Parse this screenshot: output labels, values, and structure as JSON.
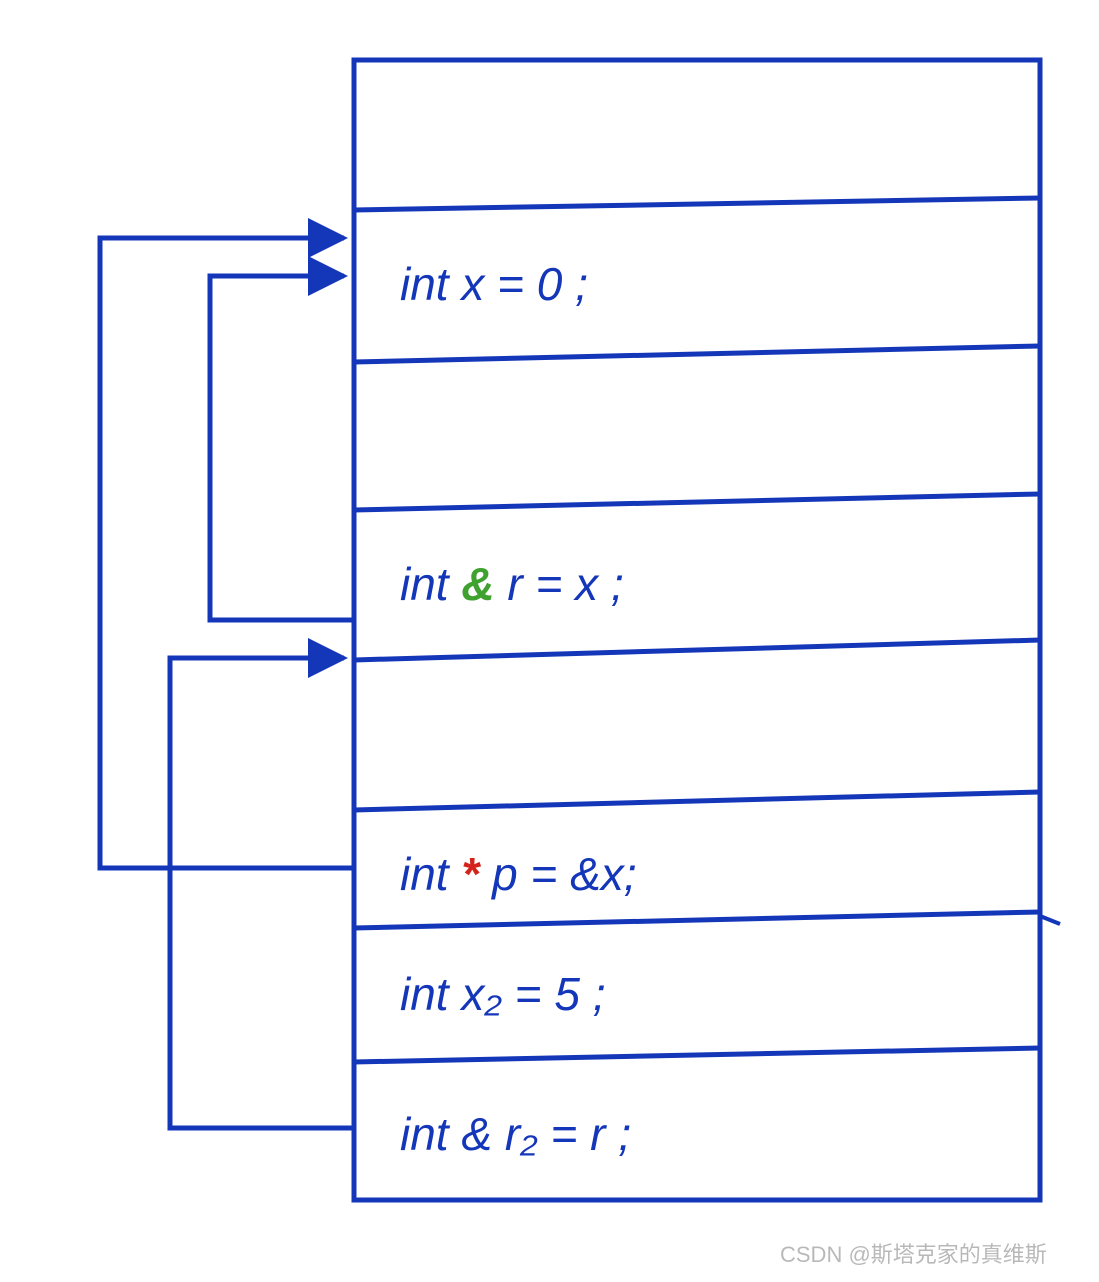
{
  "diagram": {
    "stroke": "#1436b8",
    "cells": {
      "c1": "",
      "c2_pre": "int   x = 0  ;",
      "c3": "",
      "c4_pre": "int ",
      "c4_amp": "&",
      "c4_post": " r = x ;",
      "c5": "",
      "c6_pre": "int ",
      "c6_star": "*",
      "c6_post": " p = &x;",
      "c7_pre": "int   x₂ = 5  ;",
      "c8_pre": "int & r₂ = r ;"
    },
    "watermark": "CSDN @斯塔克家的真维斯"
  }
}
